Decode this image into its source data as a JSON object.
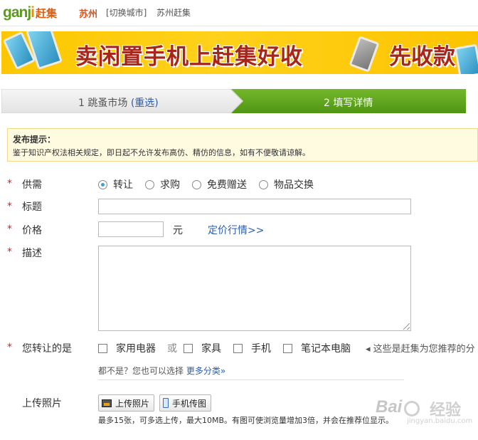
{
  "header": {
    "logo_latin": "ganji",
    "logo_cn": "赶集",
    "city": "苏州",
    "switch_city": "[切换城市]",
    "site_name": "苏州赶集"
  },
  "banner": {
    "headline": "卖闲置手机上赶集好收",
    "headline2": "先收款"
  },
  "steps": [
    {
      "number": "1",
      "label": "跳蚤市场",
      "reselect": "(重选)"
    },
    {
      "number": "2",
      "label": "填写详情"
    }
  ],
  "notice": {
    "title": "发布提示：",
    "body": "鉴于知识产权法相关规定，即日起不允许发布高仿、精仿的信息，如有不便敬请谅解。"
  },
  "form": {
    "required_mark": "*",
    "supply_label": "供需",
    "supply_options": [
      "转让",
      "求购",
      "免费赠送",
      "物品交换"
    ],
    "supply_selected": "转让",
    "title_label": "标题",
    "title_value": "",
    "price_label": "价格",
    "price_value": "",
    "price_unit": "元",
    "price_link": "定价行情>>",
    "desc_label": "描述",
    "desc_value": "",
    "category_label": "您转让的是",
    "category_options": [
      "家用电器",
      "家具",
      "手机",
      "笔记本电脑"
    ],
    "category_or": "或",
    "category_hint": "这些是赶集为您推荐的分",
    "more_prefix": "都不是？您也可以选择",
    "more_link": "更多分类»",
    "upload_label": "上传照片",
    "upload_button": "上传照片",
    "phone_upload_button": "手机传图",
    "upload_note": "最多15张，可多选上传，最大10MB。有图可使浏览量增加3倍，并会在推荐位显示。"
  },
  "watermark": {
    "brand": "Bai",
    "brand_tail": "经验",
    "url": "jingyan.baidu.com"
  }
}
